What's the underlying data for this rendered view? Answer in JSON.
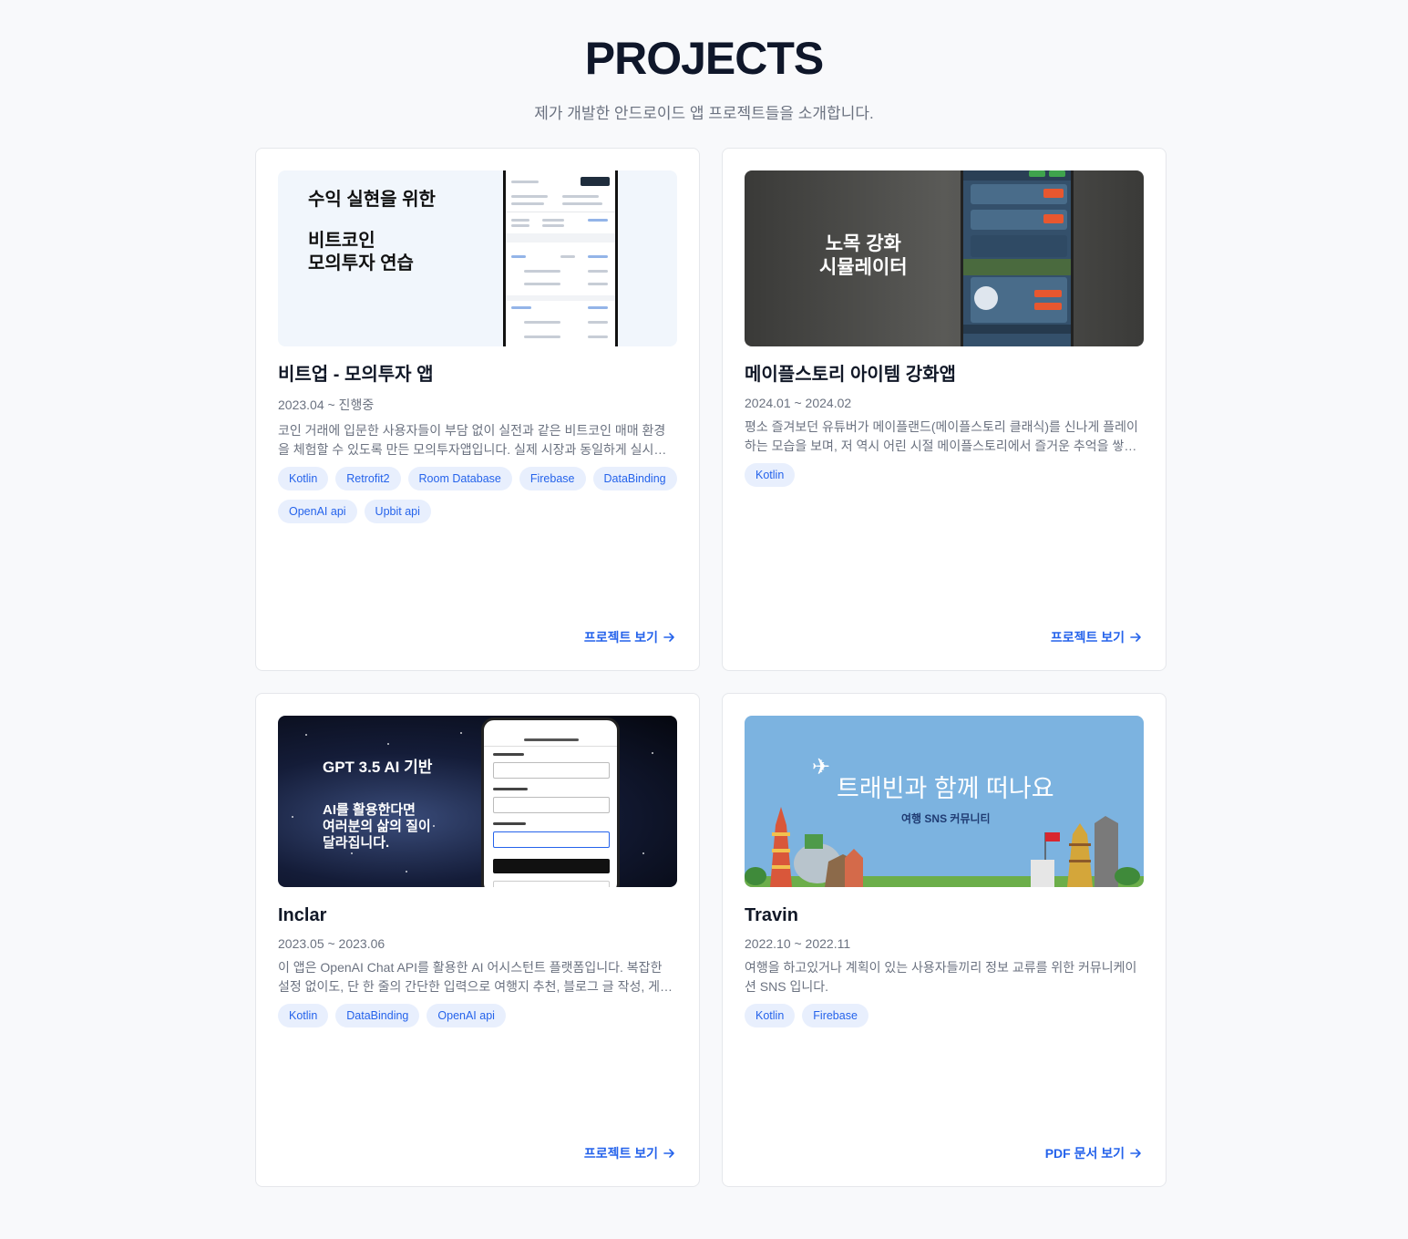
{
  "header": {
    "title": "PROJECTS",
    "subtitle": "제가 개발한 안드로이드 앱 프로젝트들을 소개합니다."
  },
  "projects": [
    {
      "thumb_text_1": "수익 실현을 위한",
      "thumb_text_2": "비트코인",
      "thumb_text_3": "모의투자 연습",
      "title": "비트업 - 모의투자 앱",
      "period": "2023.04 ~ 진행중",
      "description": "코인 거래에 입문한 사용자들이 부담 없이 실전과 같은 비트코인 매매 환경을 체험할 수 있도록 만든 모의투자앱입니다. 실제 시장과 동일하게 실시간 시세를 반영합니다.",
      "tags": [
        "Kotlin",
        "Retrofit2",
        "Room Database",
        "Firebase",
        "DataBinding",
        "OpenAI api",
        "Upbit api"
      ],
      "link_label": "프로젝트 보기"
    },
    {
      "thumb_text_1": "노목 강화",
      "thumb_text_2": "시뮬레이터",
      "title": "메이플스토리 아이템 강화앱",
      "period": "2024.01 ~ 2024.02",
      "description": "평소 즐겨보던 유튜버가 메이플랜드(메이플스토리 클래식)를 신나게 플레이하는 모습을 보며, 저 역시 어린 시절 메이플스토리에서 즐거운 추억을 쌓았던 기억이 떠올랐습니다.",
      "tags": [
        "Kotlin"
      ],
      "link_label": "프로젝트 보기"
    },
    {
      "thumb_text_1": "GPT 3.5 AI 기반",
      "thumb_text_2": "AI를 활용한다면",
      "thumb_text_3": "여러분의 삶의 질이",
      "thumb_text_4": "달라집니다.",
      "title": "Inclar",
      "period": "2023.05 ~ 2023.06",
      "description": "이 앱은 OpenAI Chat API를 활용한 AI 어시스턴트 플랫폼입니다. 복잡한 설정 없이도, 단 한 줄의 간단한 입력으로 여행지 추천, 블로그 글 작성, 게시물 작성 등을 할 수 있습니다.",
      "tags": [
        "Kotlin",
        "DataBinding",
        "OpenAI api"
      ],
      "link_label": "프로젝트 보기"
    },
    {
      "thumb_text_1": "트래빈과 함께 떠나요",
      "thumb_text_2": "여행 SNS 커뮤니티",
      "title": "Travin",
      "period": "2022.10 ~ 2022.11",
      "description": "여행을 하고있거나 계획이 있는 사용자들끼리 정보 교류를 위한 커뮤니케이션 SNS 입니다.",
      "tags": [
        "Kotlin",
        "Firebase"
      ],
      "link_label": "PDF 문서 보기"
    }
  ],
  "icons": {
    "link_arrow": "arrow-right-icon",
    "plane": "airplane-icon"
  },
  "colors": {
    "accent": "#2563eb",
    "tag_bg": "#e8effd",
    "page_bg": "#f8f9fb"
  }
}
